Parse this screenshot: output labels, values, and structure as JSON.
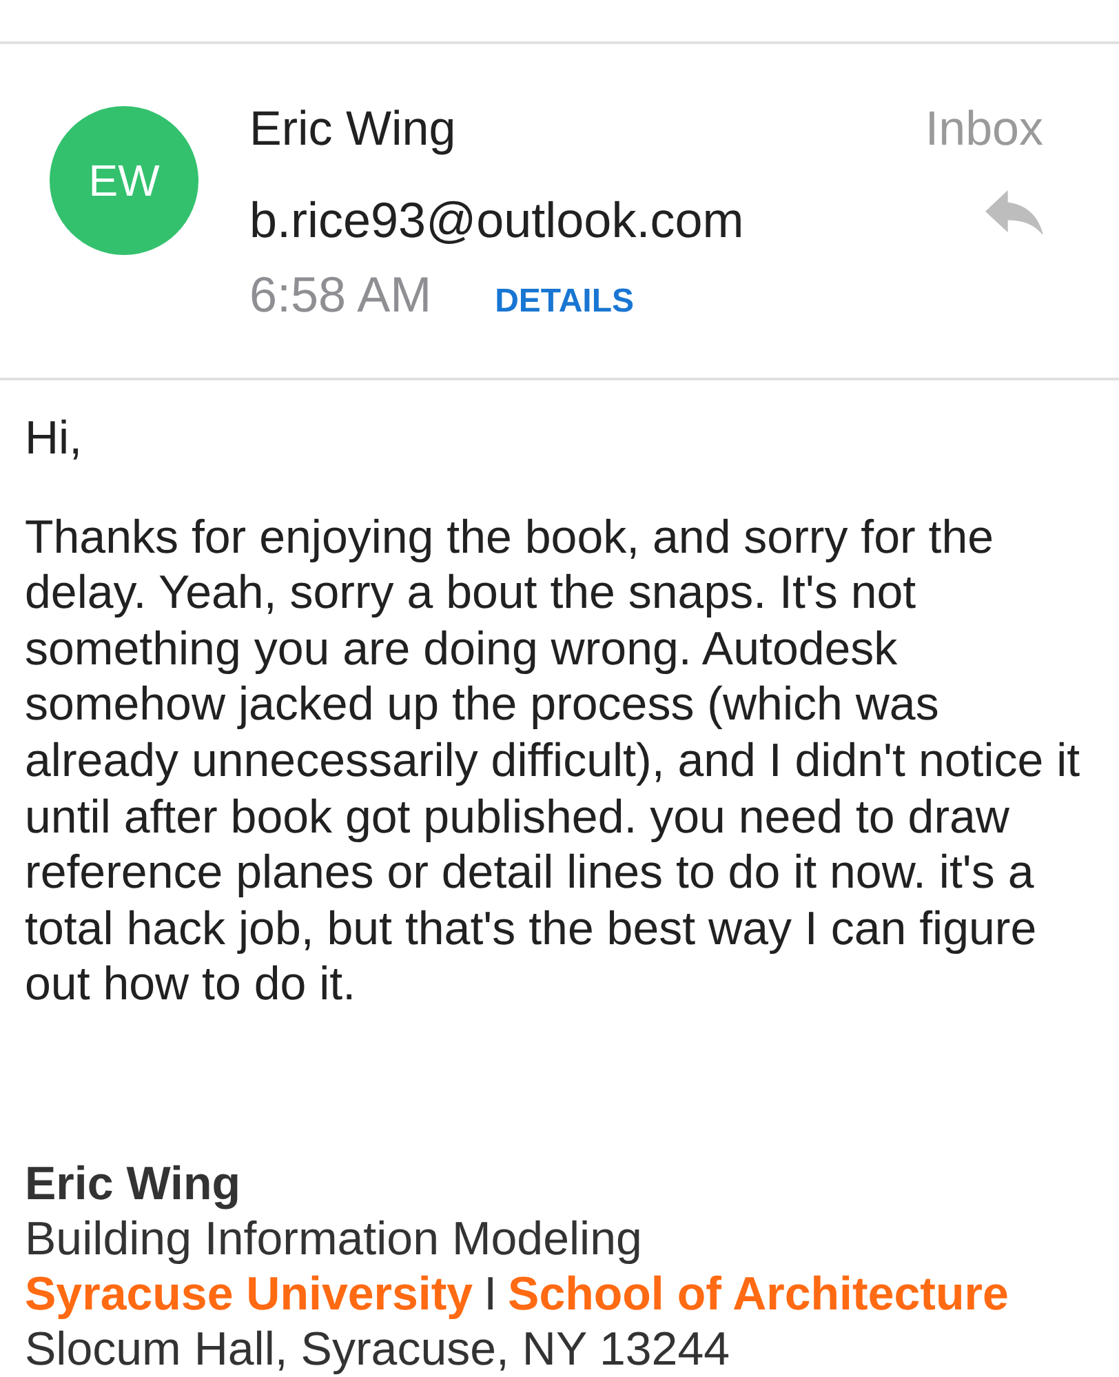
{
  "header": {
    "avatar": {
      "initials": "EW"
    },
    "sender": "Eric Wing",
    "email": "b.rice93@outlook.com",
    "time": "6:58 AM",
    "details_link": "DETAILS",
    "folder": "Inbox"
  },
  "body": {
    "greeting": "Hi,",
    "paragraph": "Thanks for enjoying the book, and sorry for the delay. Yeah, sorry a bout the snaps. It's not something you are doing wrong. Autodesk somehow jacked up the process (which was already unnecessarily difficult), and I didn't notice it until after book got published. you need to draw reference planes or detail lines to do it now. it's a total hack job, but that's the best way I can figure out how to do it."
  },
  "signature": {
    "name": "Eric Wing",
    "title": "Building Information Modeling",
    "affiliation": [
      {
        "text": "Syracuse University",
        "kind": "organization"
      },
      {
        "text": "I",
        "kind": "separator"
      },
      {
        "text": "School of Architecture",
        "kind": "organization"
      }
    ],
    "address": "Slocum Hall, Syracuse, NY 13244"
  }
}
